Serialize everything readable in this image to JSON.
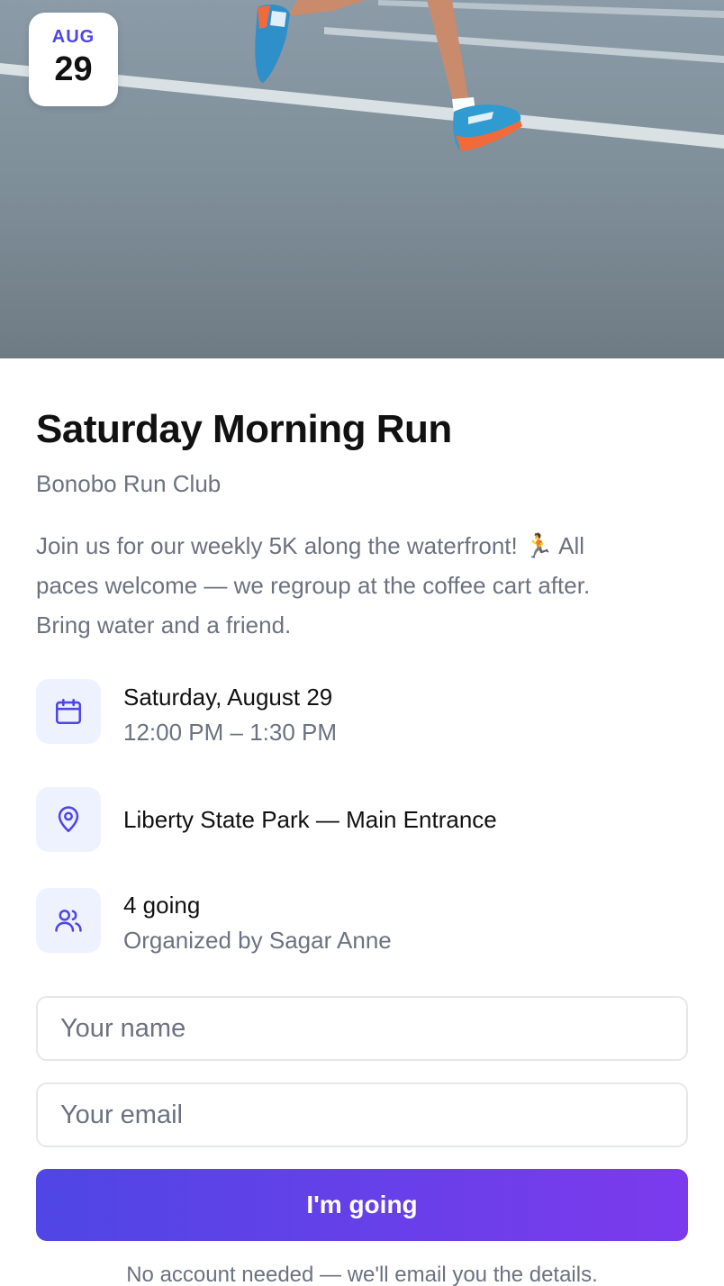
{
  "event": {
    "month": "AUG",
    "day": "29",
    "title": "Saturday Morning Run",
    "organizer_club": "Bonobo Run Club",
    "description_lines": [
      "Join us for our weekly 5K along the waterfront! 🏃 All",
      "paces welcome — we regroup at the coffee cart after.",
      "Bring water and a friend."
    ]
  },
  "details": {
    "date": {
      "icon": "calendar-icon",
      "main": "Saturday, August 29",
      "sub": "12:00 PM – 1:30 PM"
    },
    "location": {
      "icon": "map-pin-icon",
      "main": "Liberty State Park — Main Entrance"
    },
    "attendees": {
      "icon": "users-icon",
      "main": "4 going",
      "sub": "Organized by Sagar Anne"
    }
  },
  "form": {
    "name_placeholder": "Your name",
    "email_placeholder": "Your email",
    "submit_label": "I'm going",
    "footnote": "No account needed — we'll email you the details."
  },
  "colors": {
    "accent": "#4f46e5",
    "accent_end": "#7c3aed",
    "icon_bg": "#eef2ff",
    "muted_text": "#6b7280"
  }
}
